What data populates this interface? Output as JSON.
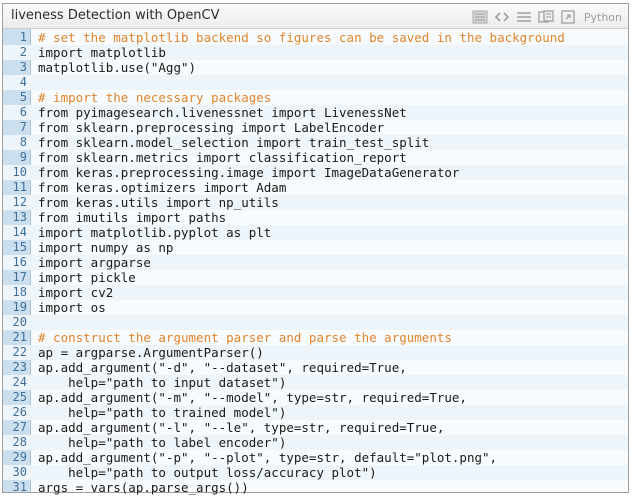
{
  "window": {
    "title": "liveness Detection with OpenCV",
    "language": "Python",
    "toolbar_icons": [
      "view-source-icon",
      "code-icon",
      "list-icon",
      "copy-icon",
      "print-icon"
    ]
  },
  "colors": {
    "gutter": "#ccdfee",
    "line_number": "#3e6f9a",
    "comment": "#e0852c",
    "code_text": "#1a1a1a"
  },
  "code": {
    "lines": [
      {
        "n": "1",
        "text": "# set the matplotlib backend so figures can be saved in the background",
        "comment": true
      },
      {
        "n": "2",
        "text": "import matplotlib"
      },
      {
        "n": "3",
        "text": "matplotlib.use(\"Agg\")"
      },
      {
        "n": "4",
        "text": ""
      },
      {
        "n": "5",
        "text": "# import the necessary packages",
        "comment": true
      },
      {
        "n": "6",
        "text": "from pyimagesearch.livenessnet import LivenessNet"
      },
      {
        "n": "7",
        "text": "from sklearn.preprocessing import LabelEncoder"
      },
      {
        "n": "8",
        "text": "from sklearn.model_selection import train_test_split"
      },
      {
        "n": "9",
        "text": "from sklearn.metrics import classification_report"
      },
      {
        "n": "10",
        "text": "from keras.preprocessing.image import ImageDataGenerator"
      },
      {
        "n": "11",
        "text": "from keras.optimizers import Adam"
      },
      {
        "n": "12",
        "text": "from keras.utils import np_utils"
      },
      {
        "n": "13",
        "text": "from imutils import paths"
      },
      {
        "n": "14",
        "text": "import matplotlib.pyplot as plt"
      },
      {
        "n": "15",
        "text": "import numpy as np"
      },
      {
        "n": "16",
        "text": "import argparse"
      },
      {
        "n": "17",
        "text": "import pickle"
      },
      {
        "n": "18",
        "text": "import cv2"
      },
      {
        "n": "19",
        "text": "import os"
      },
      {
        "n": "20",
        "text": ""
      },
      {
        "n": "21",
        "text": "# construct the argument parser and parse the arguments",
        "comment": true
      },
      {
        "n": "22",
        "text": "ap = argparse.ArgumentParser()"
      },
      {
        "n": "23",
        "text": "ap.add_argument(\"-d\", \"--dataset\", required=True,"
      },
      {
        "n": "24",
        "text": "    help=\"path to input dataset\")"
      },
      {
        "n": "25",
        "text": "ap.add_argument(\"-m\", \"--model\", type=str, required=True,"
      },
      {
        "n": "26",
        "text": "    help=\"path to trained model\")"
      },
      {
        "n": "27",
        "text": "ap.add_argument(\"-l\", \"--le\", type=str, required=True,"
      },
      {
        "n": "28",
        "text": "    help=\"path to label encoder\")"
      },
      {
        "n": "29",
        "text": "ap.add_argument(\"-p\", \"--plot\", type=str, default=\"plot.png\","
      },
      {
        "n": "30",
        "text": "    help=\"path to output loss/accuracy plot\")"
      },
      {
        "n": "31",
        "text": "args = vars(ap.parse_args())"
      }
    ]
  }
}
